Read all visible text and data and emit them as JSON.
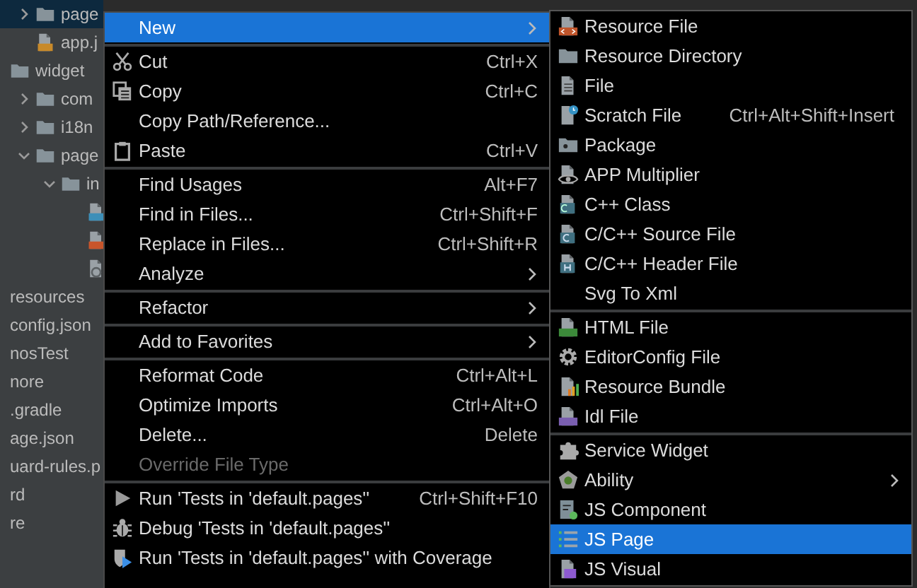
{
  "project_tree": [
    {
      "children": [
        {
          "children": [
            {
              "label": "page",
              "kind": "folder",
              "expanded": false,
              "selected": true
            },
            {
              "label": "app.j",
              "kind": "js",
              "selected": false
            }
          ]
        },
        {
          "label": "widget",
          "kind": "folder",
          "selected": false,
          "children": [
            {
              "label": "com",
              "kind": "folder",
              "expanded": false,
              "selected": false
            },
            {
              "label": "i18n",
              "kind": "folder",
              "expanded": false,
              "selected": false
            },
            {
              "label": "page",
              "kind": "folder",
              "expanded": true,
              "selected": false,
              "children": [
                {
                  "label": "in",
                  "kind": "folder",
                  "expanded": true,
                  "selected": false,
                  "children": [
                    {
                      "kind": "css",
                      "selected": false
                    },
                    {
                      "kind": "html",
                      "selected": false
                    },
                    {
                      "kind": "other",
                      "selected": false
                    }
                  ]
                }
              ]
            }
          ]
        }
      ]
    },
    {
      "label": "resources",
      "selected": false
    },
    {
      "label": "config.json",
      "selected": false
    },
    {
      "label": "nosTest",
      "selected": false
    },
    {
      "label": "nore",
      "selected": false
    },
    {
      "label": ".gradle",
      "selected": false
    },
    {
      "label": "age.json",
      "selected": false
    },
    {
      "label": "uard-rules.p",
      "selected": false
    },
    {
      "label": "rd",
      "selected": false
    },
    {
      "label": "re",
      "selected": false
    }
  ],
  "context_menu": {
    "groups": [
      {
        "items": [
          {
            "label": "New",
            "submenu": true,
            "selected": true,
            "disabled": false
          }
        ]
      },
      {
        "items": [
          {
            "label": "Cut",
            "kind": "cut",
            "shortcut": "Ctrl+X",
            "submenu": false,
            "selected": false,
            "disabled": false
          },
          {
            "label": "Copy",
            "kind": "copy",
            "shortcut": "Ctrl+C",
            "submenu": false,
            "selected": false,
            "disabled": false
          },
          {
            "label": "Copy Path/Reference...",
            "submenu": false,
            "selected": false,
            "disabled": false
          },
          {
            "label": "Paste",
            "kind": "paste",
            "shortcut": "Ctrl+V",
            "submenu": false,
            "selected": false,
            "disabled": false
          }
        ]
      },
      {
        "items": [
          {
            "label": "Find Usages",
            "shortcut": "Alt+F7",
            "submenu": false,
            "selected": false,
            "disabled": false
          },
          {
            "label": "Find in Files...",
            "shortcut": "Ctrl+Shift+F",
            "submenu": false,
            "selected": false,
            "disabled": false
          },
          {
            "label": "Replace in Files...",
            "shortcut": "Ctrl+Shift+R",
            "submenu": false,
            "selected": false,
            "disabled": false
          },
          {
            "label": "Analyze",
            "submenu": true,
            "selected": false,
            "disabled": false
          }
        ]
      },
      {
        "items": [
          {
            "label": "Refactor",
            "submenu": true,
            "selected": false,
            "disabled": false
          }
        ]
      },
      {
        "items": [
          {
            "label": "Add to Favorites",
            "submenu": true,
            "selected": false,
            "disabled": false
          }
        ]
      },
      {
        "items": [
          {
            "label": "Reformat Code",
            "shortcut": "Ctrl+Alt+L",
            "submenu": false,
            "selected": false,
            "disabled": false
          },
          {
            "label": "Optimize Imports",
            "shortcut": "Ctrl+Alt+O",
            "submenu": false,
            "selected": false,
            "disabled": false
          },
          {
            "label": "Delete...",
            "shortcut": "Delete",
            "submenu": false,
            "selected": false,
            "disabled": false
          },
          {
            "label": "Override File Type",
            "submenu": false,
            "selected": false,
            "disabled": true
          }
        ]
      },
      {
        "items": [
          {
            "label": "Run 'Tests in 'default.pages''",
            "kind": "run",
            "shortcut": "Ctrl+Shift+F10",
            "submenu": false,
            "selected": false,
            "disabled": false
          },
          {
            "label": "Debug 'Tests in 'default.pages''",
            "kind": "debug",
            "submenu": false,
            "selected": false,
            "disabled": false
          },
          {
            "label": "Run 'Tests in 'default.pages'' with Coverage",
            "kind": "coverage",
            "submenu": false,
            "selected": false,
            "disabled": false
          }
        ]
      }
    ]
  },
  "new_submenu": {
    "groups": [
      {
        "items": [
          {
            "label": "Resource File",
            "kind": "resource-file",
            "submenu": false,
            "selected": false
          },
          {
            "label": "Resource Directory",
            "kind": "folder",
            "submenu": false,
            "selected": false
          },
          {
            "label": "File",
            "kind": "file",
            "submenu": false,
            "selected": false
          },
          {
            "label": "Scratch File",
            "kind": "scratch",
            "shortcut": "Ctrl+Alt+Shift+Insert",
            "submenu": false,
            "selected": false
          },
          {
            "label": "Package",
            "kind": "package",
            "submenu": false,
            "selected": false
          },
          {
            "label": "APP Multiplier",
            "kind": "multiplier",
            "submenu": false,
            "selected": false
          },
          {
            "label": "C++ Class",
            "kind": "cpp-class",
            "submenu": false,
            "selected": false
          },
          {
            "label": "C/C++ Source File",
            "kind": "c-source",
            "submenu": false,
            "selected": false
          },
          {
            "label": "C/C++ Header File",
            "kind": "c-header",
            "submenu": false,
            "selected": false
          },
          {
            "label": "Svg To Xml",
            "submenu": false,
            "selected": false
          }
        ]
      },
      {
        "items": [
          {
            "label": "HTML File",
            "kind": "html-file",
            "submenu": false,
            "selected": false
          },
          {
            "label": "EditorConfig File",
            "kind": "gear",
            "submenu": false,
            "selected": false
          },
          {
            "label": "Resource Bundle",
            "kind": "bundle",
            "submenu": false,
            "selected": false
          },
          {
            "label": "Idl File",
            "kind": "idl",
            "submenu": false,
            "selected": false
          }
        ]
      },
      {
        "items": [
          {
            "label": "Service Widget",
            "kind": "widget",
            "submenu": false,
            "selected": false
          },
          {
            "label": "Ability",
            "kind": "ability",
            "submenu": true,
            "selected": false
          },
          {
            "label": "JS Component",
            "kind": "js-component",
            "submenu": false,
            "selected": false
          },
          {
            "label": "JS Page",
            "kind": "js-page",
            "submenu": false,
            "selected": true
          },
          {
            "label": "JS Visual",
            "kind": "js-visual",
            "submenu": false,
            "selected": false
          }
        ]
      }
    ]
  }
}
